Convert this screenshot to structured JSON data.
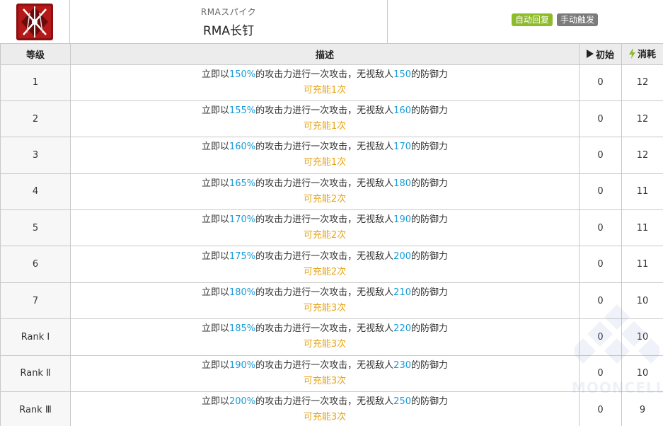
{
  "skill": {
    "name_jp": "RMAスパイク",
    "name_cn": "RMA长钉",
    "icon": "crossed-spikes-skill-icon",
    "tags": [
      {
        "label": "自动回复",
        "color": "#8dbb2a"
      },
      {
        "label": "手动触发",
        "color": "#7b7b7b"
      }
    ]
  },
  "table": {
    "headers": {
      "level": "等级",
      "description": "描述",
      "initial": "初始",
      "cost": "消耗"
    },
    "rows": [
      {
        "level": "1",
        "atk": "150%",
        "ignore": "150",
        "charges": "可充能1次",
        "initial": "0",
        "cost": "12"
      },
      {
        "level": "2",
        "atk": "155%",
        "ignore": "160",
        "charges": "可充能1次",
        "initial": "0",
        "cost": "12"
      },
      {
        "level": "3",
        "atk": "160%",
        "ignore": "170",
        "charges": "可充能1次",
        "initial": "0",
        "cost": "12"
      },
      {
        "level": "4",
        "atk": "165%",
        "ignore": "180",
        "charges": "可充能2次",
        "initial": "0",
        "cost": "11"
      },
      {
        "level": "5",
        "atk": "170%",
        "ignore": "190",
        "charges": "可充能2次",
        "initial": "0",
        "cost": "11"
      },
      {
        "level": "6",
        "atk": "175%",
        "ignore": "200",
        "charges": "可充能2次",
        "initial": "0",
        "cost": "11"
      },
      {
        "level": "7",
        "atk": "180%",
        "ignore": "210",
        "charges": "可充能3次",
        "initial": "0",
        "cost": "10"
      },
      {
        "level": "Rank Ⅰ",
        "atk": "185%",
        "ignore": "220",
        "charges": "可充能3次",
        "initial": "0",
        "cost": "10"
      },
      {
        "level": "Rank Ⅱ",
        "atk": "190%",
        "ignore": "230",
        "charges": "可充能3次",
        "initial": "0",
        "cost": "10"
      },
      {
        "level": "Rank Ⅲ",
        "atk": "200%",
        "ignore": "250",
        "charges": "可充能3次",
        "initial": "0",
        "cost": "9"
      }
    ]
  },
  "desc_parts": {
    "p1": "立即以",
    "p2": "的攻击力进行一次攻击，无视敌人",
    "p3": "的防御力"
  },
  "watermark": "MOONCELL",
  "colors": {
    "highlight_blue": "#1a9cd8",
    "highlight_orange": "#e6a417",
    "auto_tag": "#8dbb2a",
    "manual_tag": "#7b7b7b"
  }
}
